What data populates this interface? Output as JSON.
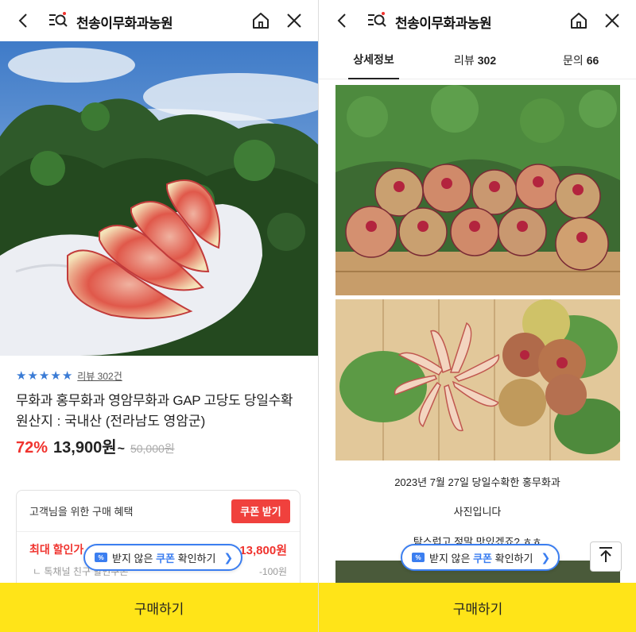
{
  "left": {
    "shop_name": "천송이무화과농원",
    "rating_stars": 5,
    "review_link": "리뷰 302건",
    "title": "무화과 홍무화과 영암무화과 GAP 고당도 당일수확",
    "origin": "원산지 : 국내산 (전라남도 영암군)",
    "discount": "72%",
    "price": "13,900원",
    "price_suffix": "~",
    "original_price": "50,000원",
    "benefit_title": "고객님을 위한 구매 혜택",
    "coupon_button": "쿠폰 받기",
    "max_discount_label": "최대 할인가",
    "max_discount_value": "13,800원",
    "sub_label": "톡채널 친구 할인쿠폰",
    "sub_value": "-100원",
    "buy_label": "구매하기"
  },
  "right": {
    "shop_name": "천송이무화과농원",
    "tabs": [
      {
        "label": "상세정보",
        "count": ""
      },
      {
        "label": "리뷰",
        "count": "302"
      },
      {
        "label": "문의",
        "count": "66"
      }
    ],
    "caption_1": "2023년 7월 27일 당일수확한 홍무화과",
    "caption_2": "사진입니다",
    "caption_3": "탐스럽고 정말 맛있겠죠? ㅎㅎ",
    "buy_label": "구매하기"
  },
  "coupon_pill": {
    "icon_text": "%",
    "prefix": "받지 않은",
    "highlight": "쿠폰",
    "suffix": "확인하기"
  },
  "colors": {
    "accent_red": "#f0332e",
    "accent_blue": "#3b7ef0",
    "buy_yellow": "#ffe418"
  }
}
